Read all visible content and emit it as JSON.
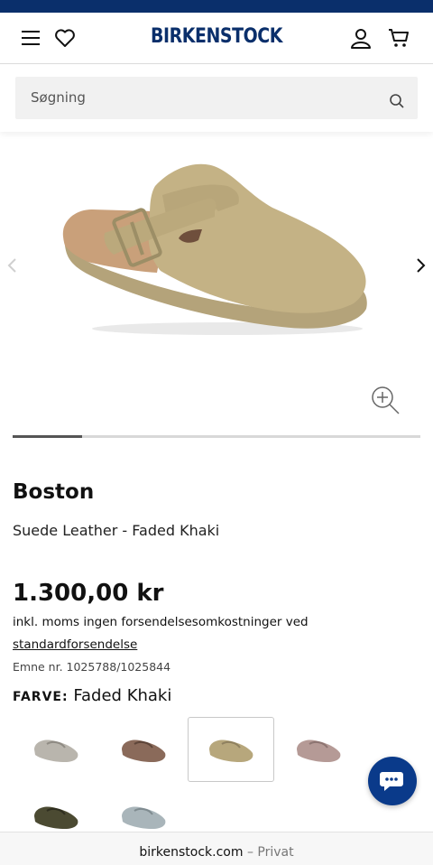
{
  "header": {
    "brand": "BIRKENSTOCK",
    "menu_icon": "hamburger-icon",
    "wishlist_icon": "heart-icon",
    "account_icon": "user-icon",
    "cart_icon": "cart-icon"
  },
  "search": {
    "placeholder": "Søgning",
    "icon": "search-icon"
  },
  "gallery": {
    "zoom_icon": "zoom-in-icon",
    "prev_icon": "chevron-left-icon",
    "next_icon": "chevron-right-icon",
    "progress": 0.17
  },
  "product": {
    "name": "Boston",
    "variant": "Suede Leather - Faded Khaki",
    "price": "1.300,00 kr",
    "tax_note": "inkl. moms ingen forsendelsesomkostninger ved",
    "tax_link": "standardforsendelse",
    "item_number": "Emne nr. 1025788/1025844",
    "color_label": "FARVE:",
    "color_value": "Faded Khaki"
  },
  "swatches": [
    {
      "name": "stone-grey",
      "color": "#b9b5ad",
      "selected": false
    },
    {
      "name": "mocha",
      "color": "#8a6a5a",
      "selected": false
    },
    {
      "name": "faded-khaki",
      "color": "#b7a77c",
      "selected": true
    },
    {
      "name": "taupe-rose",
      "color": "#b59a96",
      "selected": false
    },
    {
      "name": "thyme",
      "color": "#4b4a32",
      "selected": false
    },
    {
      "name": "blue-grey",
      "color": "#a9b5ba",
      "selected": false
    }
  ],
  "chat": {
    "icon": "chat-bubble-icon"
  },
  "browser": {
    "domain": "birkenstock.com",
    "mode": "– Privat"
  },
  "colors": {
    "brand_blue": "#0a2f6b",
    "chat_blue": "#0a3a8a"
  }
}
